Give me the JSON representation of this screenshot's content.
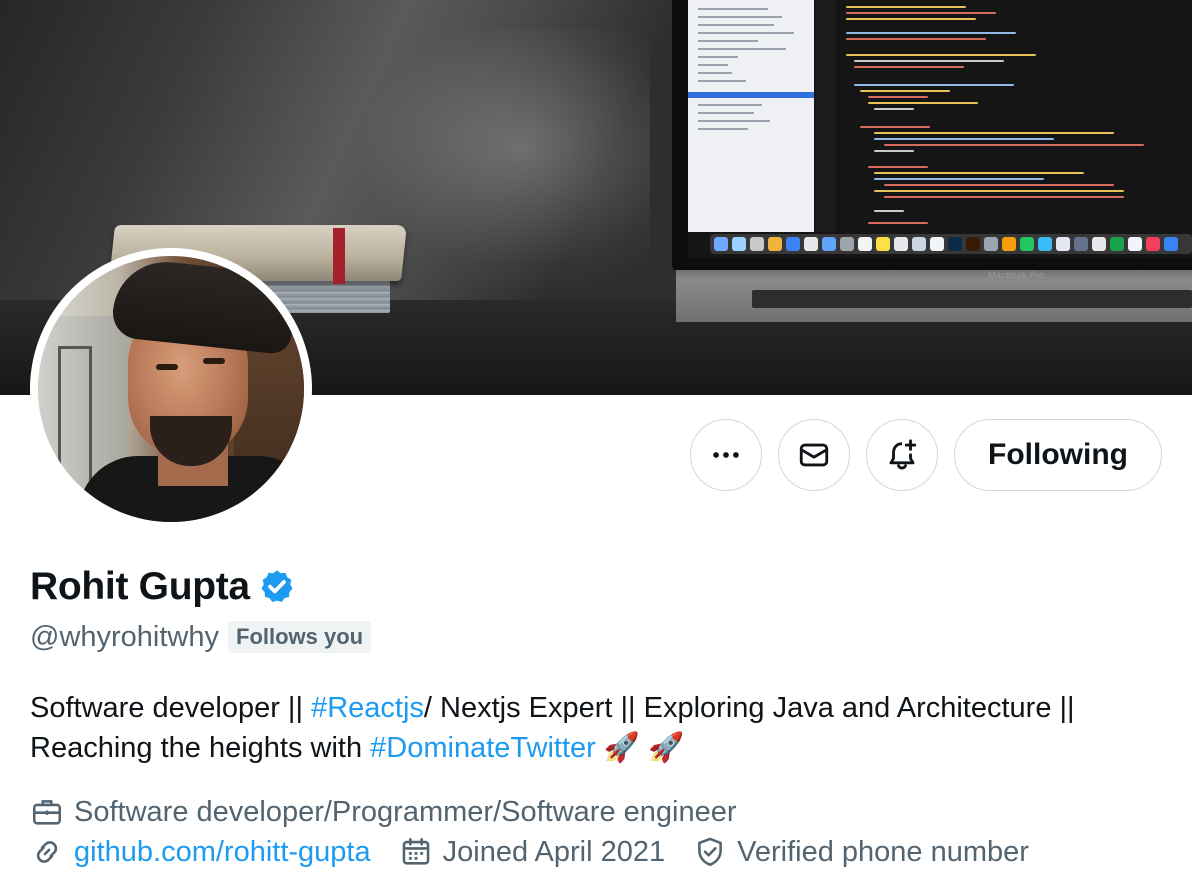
{
  "profile": {
    "name": "Rohit Gupta",
    "handle": "@whyrohitwhy",
    "follows_you": "Follows you",
    "verified": true,
    "bio": {
      "text1": "Software developer || ",
      "tag1": "#Reactjs",
      "text2": "/ Nextjs Expert || Exploring Java and Architecture || Reaching the heights with ",
      "tag2": "#DominateTwitter",
      "text3": " 🚀 🚀"
    },
    "profession": "Software developer/Programmer/Software engineer",
    "website": "github.com/rohitt-gupta",
    "joined": "Joined April 2021",
    "verified_phone": "Verified phone number"
  },
  "banner": {
    "laptop_brand": "MacBook Pro"
  },
  "actions": {
    "more": "more-icon",
    "message": "envelope-icon",
    "notify": "bell-plus-icon",
    "follow_label": "Following"
  },
  "colors": {
    "accent": "#1d9bf0",
    "text_primary": "#0f1419",
    "text_secondary": "#536471",
    "border": "#cfd9de",
    "badge_bg": "#eff3f4"
  }
}
